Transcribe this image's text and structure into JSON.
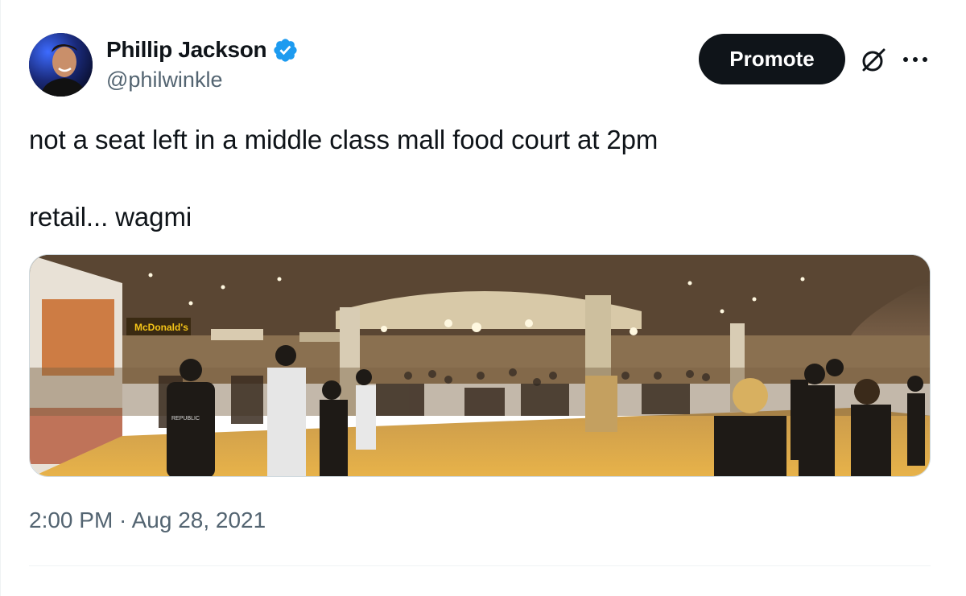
{
  "author": {
    "display_name": "Phillip Jackson",
    "handle": "@philwinkle",
    "verified": true,
    "avatar_icon": "user-avatar"
  },
  "header_actions": {
    "promote_label": "Promote",
    "grok_icon": "grok-icon",
    "more_icon": "more-options-icon"
  },
  "tweet": {
    "text_line_1": "not a seat left in a middle class mall food court at 2pm",
    "text_line_2": "retail... wagmi",
    "timestamp": "2:00 PM · Aug 28, 2021"
  },
  "media": {
    "signs": {
      "mcdonalds": "McDonald's"
    },
    "shirt_text": "REPUBLIC"
  },
  "colors": {
    "text_primary": "#0f1419",
    "text_secondary": "#536471",
    "verified_blue": "#1d9bf0",
    "promote_bg": "#0f1419",
    "border": "#eff3f4"
  }
}
